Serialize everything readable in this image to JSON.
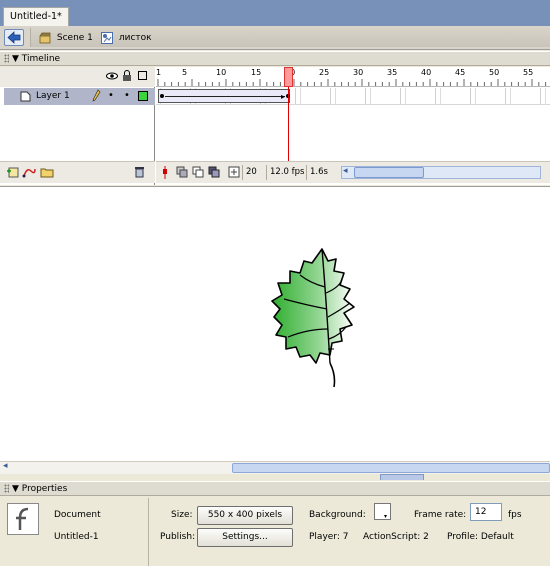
{
  "document": {
    "tab_title": "Untitled-1*"
  },
  "breadcrumb": {
    "scene": "Scene 1",
    "symbol": "листок"
  },
  "timeline": {
    "panel_title": "Timeline",
    "ruler_numbers": [
      "1",
      "5",
      "10",
      "15",
      "20",
      "25",
      "30",
      "35",
      "40",
      "45",
      "50",
      "55"
    ],
    "layer_name": "Layer 1",
    "current_frame": "20",
    "frame_rate": "12.0 fps",
    "elapsed": "1.6s"
  },
  "properties": {
    "panel_title": "Properties",
    "doc_type": "Document",
    "doc_name": "Untitled-1",
    "size_label": "Size:",
    "size_value": "550 x 400 pixels",
    "publish_label": "Publish:",
    "settings_label": "Settings...",
    "background_label": "Background:",
    "frame_rate_label": "Frame rate:",
    "frame_rate_value": "12",
    "fps_label": "fps",
    "player_label": "Player: 7",
    "actionscript_label": "ActionScript: 2",
    "profile_label": "Profile: Default"
  },
  "colors": {
    "background": "#ffffff",
    "leaf_green": "#2fae2f",
    "playhead": "#e00000"
  }
}
